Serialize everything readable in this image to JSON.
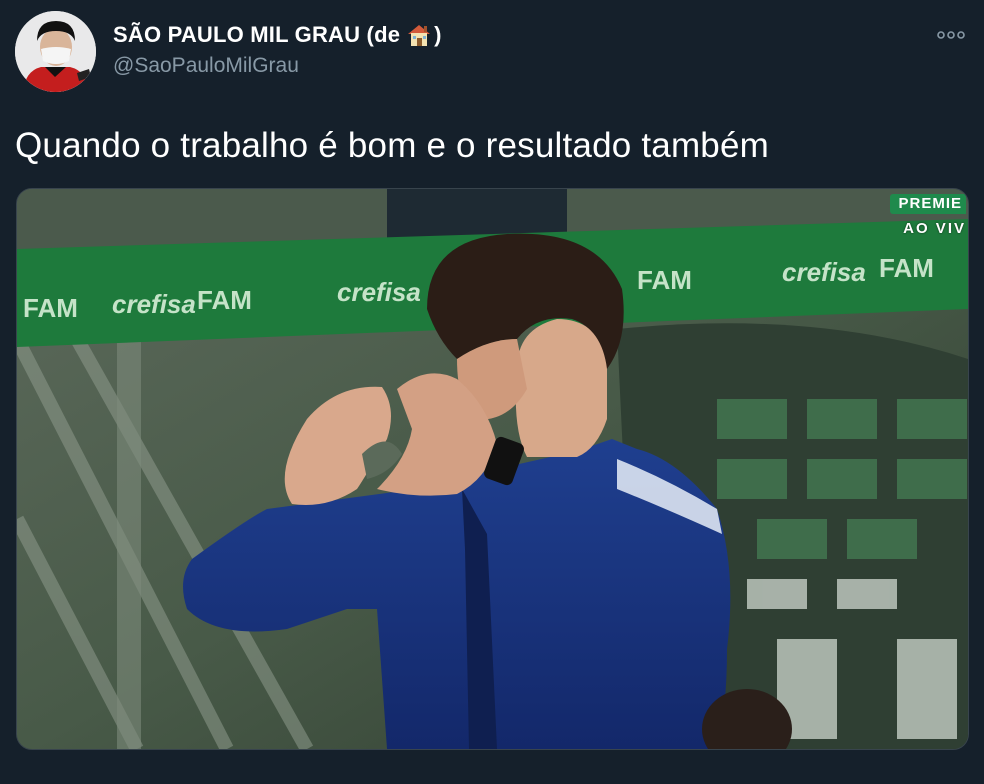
{
  "tweet": {
    "display_name": "SÃO PAULO MIL GRAU (de",
    "display_name_suffix": ")",
    "handle": "@SaoPauloMilGrau",
    "text": "Quando o trabalho é bom e o resultado também",
    "footer": ""
  },
  "media": {
    "broadcaster_label": "PREMIE",
    "live_label": "AO VIV",
    "banner_words": [
      "FAM",
      "crefisa",
      "FAM",
      "crefisa",
      "FAM",
      "crefisa",
      "FAM"
    ]
  },
  "icons": {
    "house": "house-emoji-icon",
    "more": "more-options-icon"
  },
  "colors": {
    "background": "#15202b",
    "secondary_text": "#8899a6",
    "banner_green": "#1e7a3c"
  }
}
